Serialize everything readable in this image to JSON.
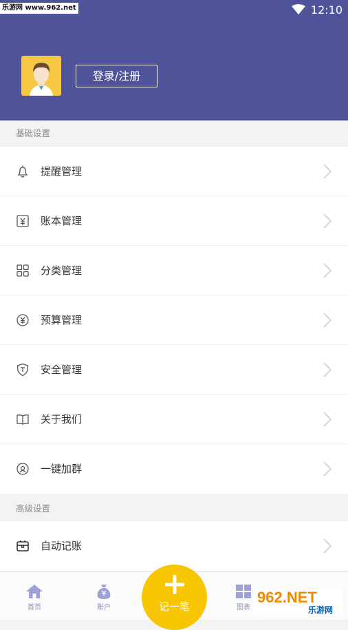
{
  "status_bar": {
    "watermark": "乐游网 www.962.net",
    "time": "12:10",
    "wifi_icon": "wifi-icon"
  },
  "header": {
    "background_color": "#4f5399",
    "avatar_icon": "user-avatar-icon",
    "login_label": "登录/注册"
  },
  "basic_settings": {
    "title": "基础设置",
    "items": [
      {
        "label": "提醒管理",
        "icon": "bell-icon"
      },
      {
        "label": "账本管理",
        "icon": "ledger-icon"
      },
      {
        "label": "分类管理",
        "icon": "grid-icon"
      },
      {
        "label": "预算管理",
        "icon": "yen-coin-icon"
      },
      {
        "label": "安全管理",
        "icon": "shield-icon"
      },
      {
        "label": "关于我们",
        "icon": "book-icon"
      },
      {
        "label": "一键加群",
        "icon": "group-icon"
      }
    ]
  },
  "advanced_settings": {
    "title": "高级设置",
    "items": [
      {
        "label": "自动记账",
        "icon": "auto-record-icon"
      }
    ]
  },
  "tab_bar": {
    "tabs": [
      {
        "label": "首页",
        "icon": "home-icon"
      },
      {
        "label": "账户",
        "icon": "money-bag-icon"
      },
      {
        "label": "图表",
        "icon": "chart-icon"
      }
    ],
    "fab_label": "记一笔",
    "fab_color": "#f7c600"
  },
  "watermark_bottom": {
    "logo": "962.NET",
    "text": "乐游网"
  }
}
